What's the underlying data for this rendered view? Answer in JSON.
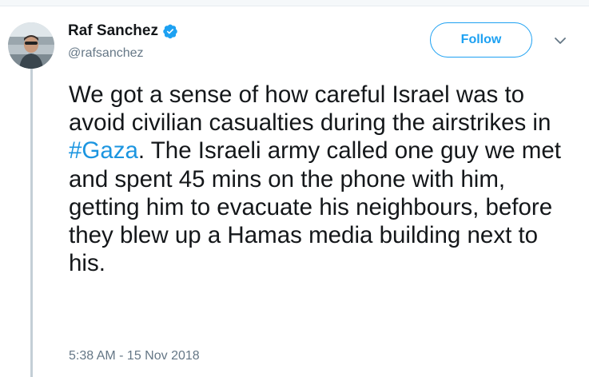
{
  "tweet": {
    "author": {
      "display_name": "Raf Sanchez",
      "handle": "@rafsanchez",
      "verified_icon": "verified-badge-icon",
      "avatar": "profile-photo"
    },
    "follow_label": "Follow",
    "more_icon": "chevron-down-icon",
    "text_before": "We got a sense of how careful Israel was to avoid civilian casualties during the airstrikes in ",
    "hashtag": "#Gaza",
    "text_after": ". The Israeli army called one guy we met and spent 45 mins on the phone with him, getting him to evacuate his neighbours, before they blew up a Hamas media building next to his.",
    "timestamp": "5:38 AM - 15 Nov 2018"
  },
  "colors": {
    "accent": "#1da1f2",
    "hashtag": "#1b95e0",
    "text": "#14171a",
    "secondary": "#657786",
    "thread_line": "#c4cfd6"
  }
}
